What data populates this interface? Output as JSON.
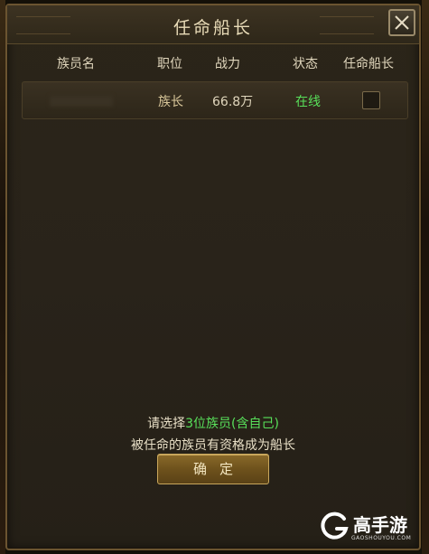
{
  "dialog": {
    "title": "任命船长",
    "close_icon": "close-icon"
  },
  "table": {
    "headers": [
      "族员名",
      "职位",
      "战力",
      "状态",
      "任命船长"
    ],
    "rows": [
      {
        "name": "",
        "role": "族长",
        "power": "66.8万",
        "status": "在线",
        "appoint_checked": false
      }
    ]
  },
  "notice": {
    "line1_prefix": "请选择",
    "line1_highlight": "3位族员(含自己)",
    "line2": "被任命的族员有资格成为船长"
  },
  "confirm_button": {
    "label": "确定"
  },
  "watermark": {
    "brand": "高手游",
    "domain": "GAOSHOUYOU.COM"
  },
  "colors": {
    "accent_green": "#58e05a",
    "text_light": "#e8dfc6",
    "gold": "#c9a75c"
  }
}
